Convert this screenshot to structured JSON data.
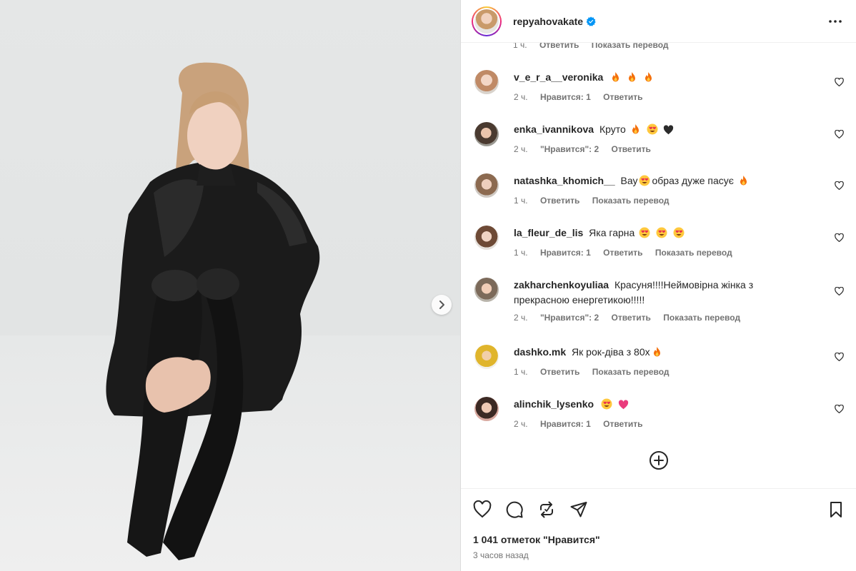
{
  "post": {
    "username": "repyahovakate",
    "likes_text": "1 041 отметок \"Нравится\"",
    "time_text": "3 часов назад"
  },
  "icons": {
    "more": "more-horizontal-icon",
    "verified": "verified-badge-icon",
    "like": "heart-icon",
    "comment": "comment-icon",
    "repost": "repost-icon",
    "share": "send-icon",
    "save": "bookmark-icon",
    "load_more": "plus-circle-icon",
    "next": "chevron-right-icon"
  },
  "colors": {
    "verified": "#0095f6",
    "text": "#262626",
    "muted": "#737373"
  },
  "cut_row": {
    "time": "1 ч.",
    "reply": "Ответить",
    "translate": "Показать перевод"
  },
  "comments": [
    {
      "username": "v_e_r_a__veronika",
      "text": "",
      "emojis": [
        "fire",
        "fire",
        "fire"
      ],
      "time": "2 ч.",
      "likes": "Нравится: 1",
      "reply": "Ответить",
      "translate": ""
    },
    {
      "username": "enka_ivannikova",
      "text": "Круто",
      "emojis": [
        "fire",
        "heart-eyes",
        "black-heart"
      ],
      "time": "2 ч.",
      "likes": "\"Нравится\": 2",
      "reply": "Ответить",
      "translate": ""
    },
    {
      "username": "natashka_khomich__",
      "text_before": "Вау",
      "text": "образ дуже пасує",
      "emojis": [
        "heart-eyes",
        "fire"
      ],
      "time": "1 ч.",
      "likes": "",
      "reply": "Ответить",
      "translate": "Показать перевод"
    },
    {
      "username": "la_fleur_de_lis",
      "text": "Яка гарна",
      "emojis": [
        "heart-eyes",
        "heart-eyes",
        "heart-eyes"
      ],
      "time": "1 ч.",
      "likes": "Нравится: 1",
      "reply": "Ответить",
      "translate": "Показать перевод"
    },
    {
      "username": "zakharchenkoyuliaa",
      "text": "Красуня!!!!Неймовірна жінка з прекрасною енергетикою!!!!!",
      "emojis": [],
      "time": "2 ч.",
      "likes": "\"Нравится\": 2",
      "reply": "Ответить",
      "translate": "Показать перевод"
    },
    {
      "username": "dashko.mk",
      "text": "Як рок-діва з 80х",
      "emojis": [
        "fire"
      ],
      "time": "1 ч.",
      "likes": "",
      "reply": "Ответить",
      "translate": "Показать перевод"
    },
    {
      "username": "alinchik_lysenko",
      "text": "",
      "emojis": [
        "heart-eyes",
        "pink-heart"
      ],
      "time": "2 ч.",
      "likes": "Нравится: 1",
      "reply": "Ответить",
      "translate": ""
    }
  ]
}
